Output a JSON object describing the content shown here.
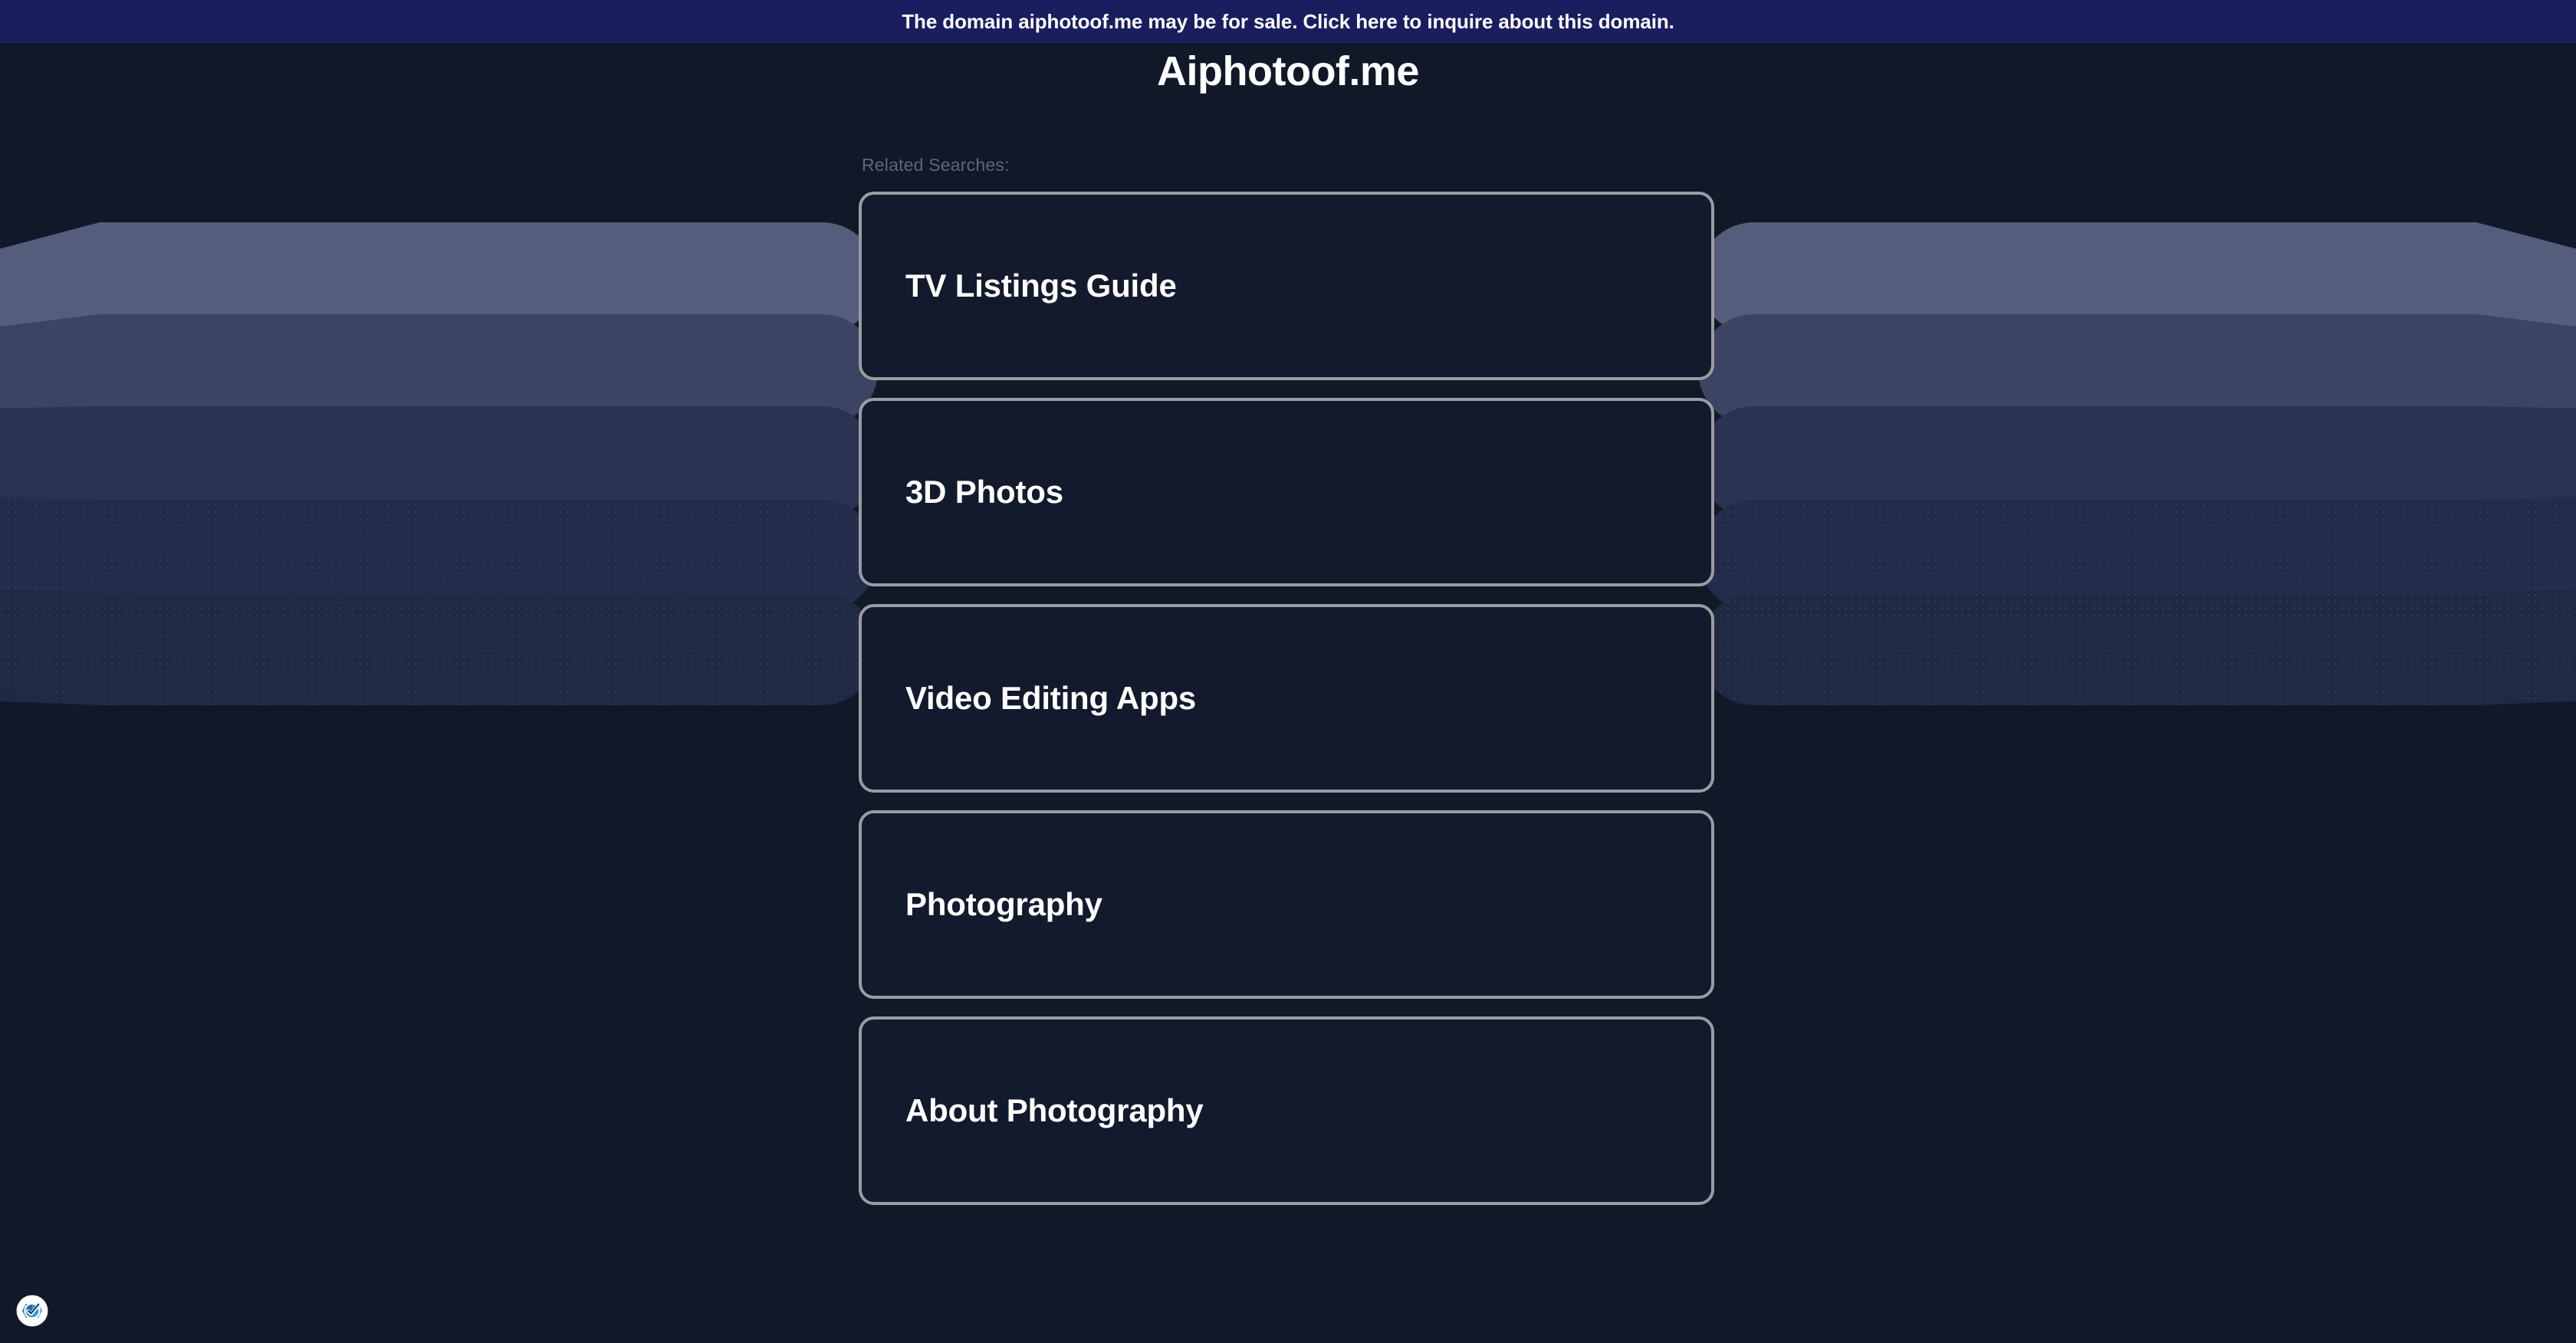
{
  "banner": {
    "name": "domain-sale-banner",
    "text": "The domain aiphotoof.me may be for sale. Click here to inquire about this domain.",
    "background_color": "#1a1d5e",
    "text_color": "#ffffff"
  },
  "page": {
    "title": "Aiphotoof.me",
    "background_color": "#111828",
    "title_color": "#ffffff"
  },
  "related": {
    "heading": "Related Searches:",
    "heading_color": "#5c6582",
    "card_border_color": "#9a9ca2",
    "card_fill_color": "#131a2d",
    "card_text_color": "#ffffff",
    "items": [
      {
        "label": "TV Listings Guide"
      },
      {
        "label": "3D Photos"
      },
      {
        "label": "Video Editing Apps"
      },
      {
        "label": "Photography"
      },
      {
        "label": "About Photography"
      }
    ]
  },
  "decoration": {
    "bar_colors": [
      "#555d7d",
      "#3c4463",
      "#2b3352",
      "#232c4b",
      "#202944"
    ],
    "shape": "tapered-stacked-bars"
  },
  "trust_badge": {
    "icon": "verified-check-badge-icon",
    "ring_color": "#ffffff",
    "shield_color": "#1b6fb5",
    "accent_color": "#2e9ad6",
    "check_color": "#ffffff"
  }
}
